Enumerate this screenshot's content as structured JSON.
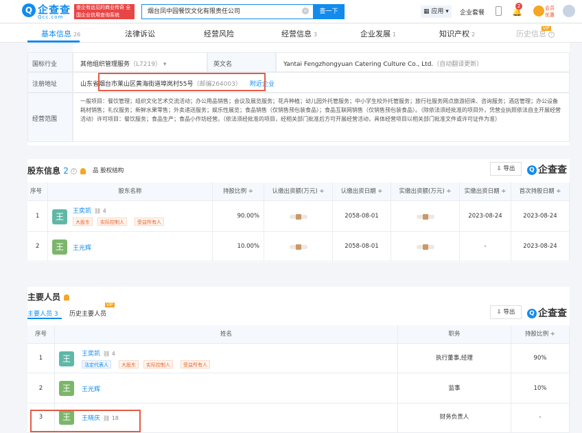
{
  "header": {
    "logo_text": "企查查",
    "logo_sub": "Qcc.com",
    "slogan": "查企有远见的商业传奇 全国企业信用查询系统",
    "search_value": "烟台凤中园餐饮文化有限责任公司",
    "search_button": "查一下",
    "app_label": "应用",
    "package_label": "企业套餐",
    "notification_count": "2",
    "vip_label": "会员优惠"
  },
  "tabs": [
    {
      "label": "基本信息",
      "count": "26"
    },
    {
      "label": "法律诉讼",
      "count": ""
    },
    {
      "label": "经营风险",
      "count": ""
    },
    {
      "label": "经营信息",
      "count": "3"
    },
    {
      "label": "企业发展",
      "count": "1"
    },
    {
      "label": "知识产权",
      "count": "2"
    },
    {
      "label": "历史信息",
      "count": ""
    }
  ],
  "vip_tag": "VIP",
  "business_info": {
    "industry_label": "国标行业",
    "industry_value": "其他组织管理服务",
    "industry_code": "（L7219）",
    "english_label": "英文名",
    "english_value": "Yantai Fengzhongyuan Catering Culture Co., Ltd.",
    "english_note": "（自动翻译更新）",
    "address_label": "注册地址",
    "address_value": "山东省烟台市莱山区黄海街道埠岚村55号",
    "postcode": "（邮编264003）",
    "nearby_link": "附近企业",
    "scope_label": "经营范围",
    "scope_value": "一般项目：餐饮管理；组织文化艺术交流活动；办公用品销售；会议及展览服务；花卉种植；幼儿园外托管服务；中小学生校外托管服务；旅行社服务网点旅游招徕、咨询服务；酒店管理；办公设备耗材销售；礼仪服务；新鲜水果零售；外卖递送服务；娱乐性展览；食品销售（仅销售预包装食品）；食品互联网销售（仅销售预包装食品）。（除依法须经批准的项目外，凭营业执照依法自主开展经营活动）许可项目：餐饮服务；食品生产；食品小作坊经营。（依法须经批准的项目，经相关部门批准后方可开展经营活动，具体经营项目以相关部门批准文件或许可证件为准）"
  },
  "shareholders": {
    "title": "股东信息",
    "count": "2",
    "structure_label": "股权结构",
    "export_label": "导出",
    "brand": "企查查",
    "columns": [
      "序号",
      "股东名称",
      "持股比例 ÷",
      "认缴出资额(万元) ÷",
      "认缴出资日期 ÷",
      "实缴出资额(万元) ÷",
      "实缴出资日期 ÷",
      "首次持股日期 ÷"
    ],
    "rows": [
      {
        "index": "1",
        "avatar": "王",
        "name": "王奕凯",
        "count": "4",
        "tags": [
          "大股东",
          "实际控制人",
          "受益所有人"
        ],
        "ratio": "90.00%",
        "sub_date": "2058-08-01",
        "paid_date": "2023-08-24",
        "first_date": "2023-08-24"
      },
      {
        "index": "2",
        "avatar": "王",
        "name": "王光辉",
        "count": "",
        "tags": [],
        "ratio": "10.00%",
        "sub_date": "2058-08-01",
        "paid_date": "-",
        "first_date": "2023-08-24"
      }
    ]
  },
  "personnel": {
    "title": "主要人员",
    "tab_current": "主要人员",
    "tab_current_count": "3",
    "tab_history": "历史主要人员",
    "export_label": "导出",
    "brand": "企查查",
    "columns": [
      "序号",
      "姓名",
      "职务",
      "持股比例 ÷"
    ],
    "rows": [
      {
        "index": "1",
        "avatar": "王",
        "name": "王奕凯",
        "count": "4",
        "tags": [
          "法定代表人",
          "大股东",
          "实际控制人",
          "受益所有人"
        ],
        "position": "执行董事,经理",
        "ratio": "90%"
      },
      {
        "index": "2",
        "avatar": "王",
        "name": "王光辉",
        "count": "",
        "tags": [],
        "position": "监事",
        "ratio": "10%"
      },
      {
        "index": "3",
        "avatar": "王",
        "name": "王晓庆",
        "count": "18",
        "tags": [],
        "position": "财务负责人",
        "ratio": "-"
      }
    ]
  },
  "colors": {
    "accent": "#128bed",
    "highlight_box": "#e25b43",
    "avatar_teal": "#5fb8a7",
    "avatar_green": "#7cb66a"
  }
}
